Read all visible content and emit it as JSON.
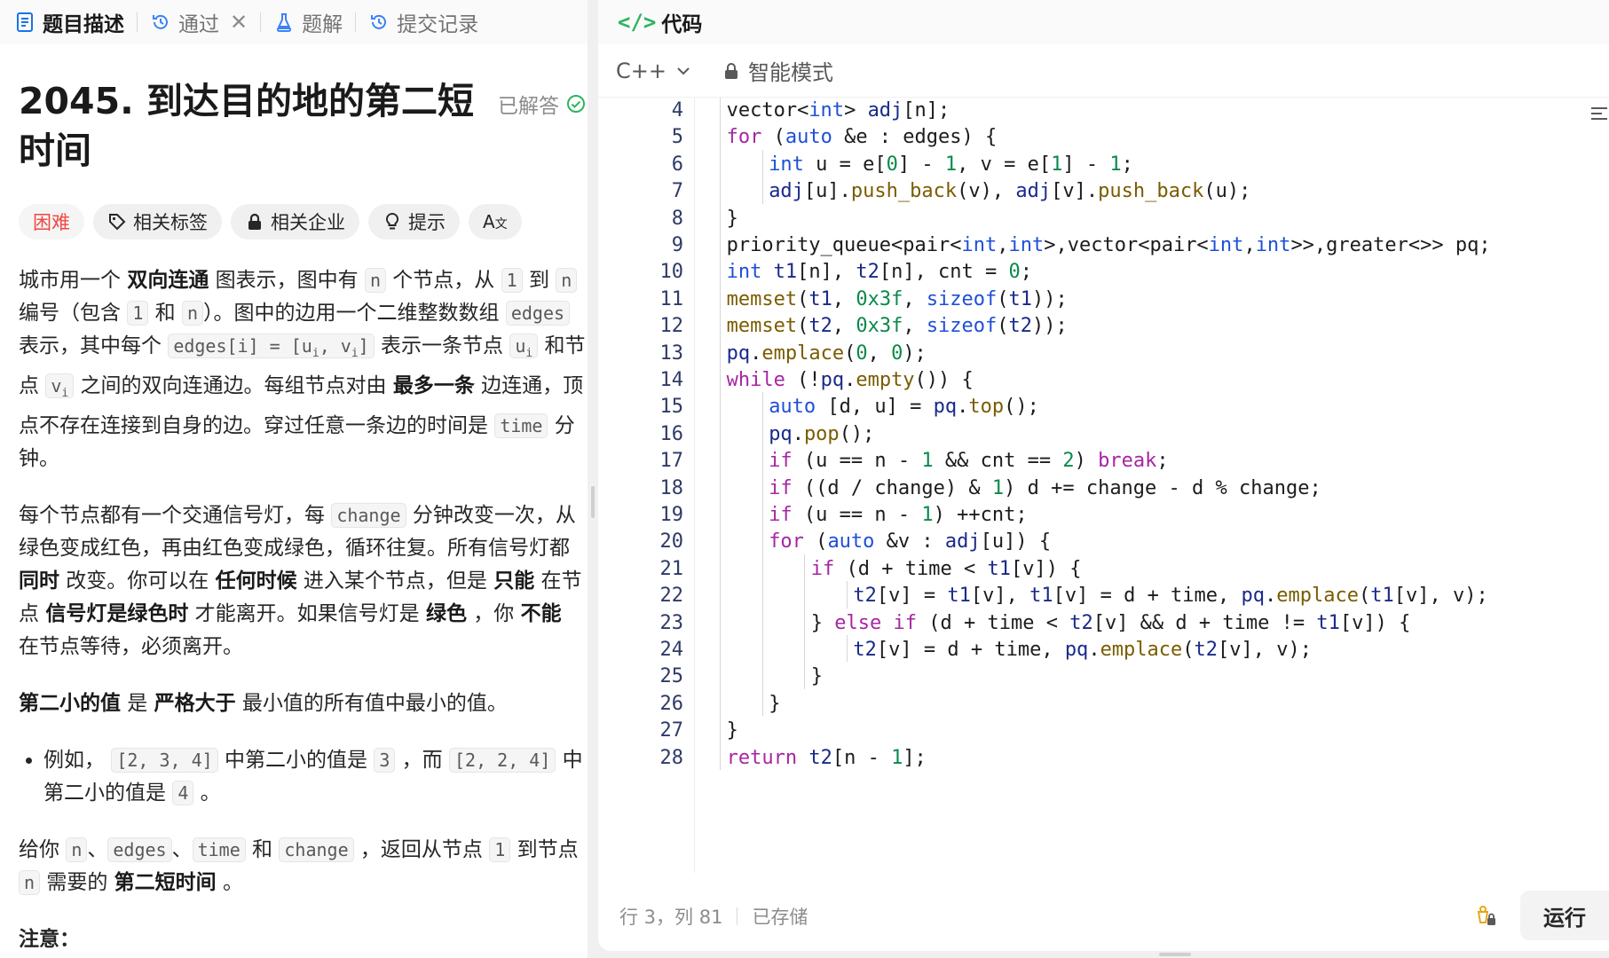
{
  "left_tabs": [
    {
      "label": "题目描述",
      "icon": "document-icon"
    },
    {
      "label": "通过",
      "icon": "history-icon"
    },
    {
      "label": "题解",
      "icon": "flask-icon"
    },
    {
      "label": "提交记录",
      "icon": "history-icon"
    }
  ],
  "question": {
    "title": "2045. 到达目的地的第二短时间",
    "status": "已解答",
    "difficulty": "困难",
    "pills": [
      "相关标签",
      "相关企业",
      "提示"
    ]
  },
  "description": {
    "p1": [
      "城市用一个 ",
      "双向连通",
      " 图表示，图中有 ",
      "n",
      " 个节点，从 ",
      "1",
      " 到 ",
      "n",
      " 编号（包含 ",
      "1",
      " 和 ",
      "n",
      "）。图中的边用一个二维整数数组 ",
      "edges",
      " 表示，其中每个 ",
      "edges[i] = [u",
      "i",
      ", v",
      "i",
      "]",
      " 表示一条节点 ",
      "u",
      "i",
      " 和节点 ",
      "v",
      "i",
      " 之间的双向连通边。每组节点对由 ",
      "最多一条",
      " 边连通，顶点不存在连接到自身的边。穿过任意一条边的时间是 ",
      "time",
      " 分钟。"
    ],
    "p2": [
      "每个节点都有一个交通信号灯，每 ",
      "change",
      " 分钟改变一次，从绿色变成红色，再由红色变成绿色，循环往复。所有信号灯都 ",
      "同时",
      " 改变。你可以在 ",
      "任何时候",
      " 进入某个节点，但是 ",
      "只能",
      " 在节点 ",
      "信号灯是绿色时",
      " 才能离开。如果信号灯是  ",
      "绿色",
      " ，你 ",
      "不能",
      " 在节点等待，必须离开。"
    ],
    "p3": [
      "第二小的值",
      " 是 ",
      "严格大于",
      " 最小值的所有值中最小的值。"
    ],
    "li1": [
      "例如， ",
      "[2, 3, 4]",
      " 中第二小的值是 ",
      "3",
      " ，而 ",
      "[2, 2, 4]",
      " 中第二小的值是 ",
      "4",
      " 。"
    ],
    "p4": [
      "给你 ",
      "n",
      "、",
      "edges",
      "、",
      "time",
      " 和 ",
      "change",
      " ，返回从节点 ",
      "1",
      " 到节点 ",
      "n",
      " 需要的 ",
      "第二短时间",
      " 。"
    ],
    "note": "注意："
  },
  "code_panel": {
    "title": "代码",
    "language": "C++",
    "mode": "智能模式",
    "status_position": "行 3，列 81",
    "status_saved": "已存储",
    "run_label": "运行"
  },
  "code_lines": [
    {
      "n": "4",
      "indent": 1,
      "t": [
        [
          "",
          "vector<"
        ],
        [
          "ty",
          "int"
        ],
        [
          "",
          "> "
        ],
        [
          "vr",
          "adj"
        ],
        [
          "",
          "[n];"
        ]
      ]
    },
    {
      "n": "5",
      "indent": 1,
      "t": [
        [
          "kw",
          "for"
        ],
        [
          "",
          " ("
        ],
        [
          "ty",
          "auto"
        ],
        [
          "",
          " &e : edges) {"
        ]
      ]
    },
    {
      "n": "6",
      "indent": 2,
      "t": [
        [
          "ty",
          "int"
        ],
        [
          "",
          " u = e["
        ],
        [
          "nm",
          "0"
        ],
        [
          "",
          "] - "
        ],
        [
          "nm",
          "1"
        ],
        [
          "",
          ", v = e["
        ],
        [
          "nm",
          "1"
        ],
        [
          "",
          "] - "
        ],
        [
          "nm",
          "1"
        ],
        [
          "",
          ";"
        ]
      ]
    },
    {
      "n": "7",
      "indent": 2,
      "t": [
        [
          "vr",
          "adj"
        ],
        [
          "",
          "[u]."
        ],
        [
          "fn",
          "push_back"
        ],
        [
          "",
          "(v), "
        ],
        [
          "vr",
          "adj"
        ],
        [
          "",
          "[v]."
        ],
        [
          "fn",
          "push_back"
        ],
        [
          "",
          "(u);"
        ]
      ]
    },
    {
      "n": "8",
      "indent": 1,
      "t": [
        [
          "",
          "}"
        ]
      ]
    },
    {
      "n": "9",
      "indent": 1,
      "t": [
        [
          "",
          "priority_queue<pair<"
        ],
        [
          "ty",
          "int"
        ],
        [
          "",
          ","
        ],
        [
          "ty",
          "int"
        ],
        [
          "",
          ">,vector<pair<"
        ],
        [
          "ty",
          "int"
        ],
        [
          "",
          ","
        ],
        [
          "ty",
          "int"
        ],
        [
          "",
          ">>,greater<>> pq;"
        ]
      ]
    },
    {
      "n": "10",
      "indent": 1,
      "t": [
        [
          "ty",
          "int"
        ],
        [
          "",
          " "
        ],
        [
          "vr",
          "t1"
        ],
        [
          "",
          "[n], "
        ],
        [
          "vr",
          "t2"
        ],
        [
          "",
          "[n], cnt = "
        ],
        [
          "nm",
          "0"
        ],
        [
          "",
          ";"
        ]
      ]
    },
    {
      "n": "11",
      "indent": 1,
      "t": [
        [
          "fn",
          "memset"
        ],
        [
          "",
          "("
        ],
        [
          "vr",
          "t1"
        ],
        [
          "",
          ", "
        ],
        [
          "nm",
          "0x3f"
        ],
        [
          "",
          ", "
        ],
        [
          "ty",
          "sizeof"
        ],
        [
          "",
          "("
        ],
        [
          "vr",
          "t1"
        ],
        [
          "",
          "));"
        ]
      ]
    },
    {
      "n": "12",
      "indent": 1,
      "t": [
        [
          "fn",
          "memset"
        ],
        [
          "",
          "("
        ],
        [
          "vr",
          "t2"
        ],
        [
          "",
          ", "
        ],
        [
          "nm",
          "0x3f"
        ],
        [
          "",
          ", "
        ],
        [
          "ty",
          "sizeof"
        ],
        [
          "",
          "("
        ],
        [
          "vr",
          "t2"
        ],
        [
          "",
          "));"
        ]
      ]
    },
    {
      "n": "13",
      "indent": 1,
      "t": [
        [
          "vr",
          "pq"
        ],
        [
          "",
          "."
        ],
        [
          "fn",
          "emplace"
        ],
        [
          "",
          "("
        ],
        [
          "nm",
          "0"
        ],
        [
          "",
          ", "
        ],
        [
          "nm",
          "0"
        ],
        [
          "",
          ");"
        ]
      ]
    },
    {
      "n": "14",
      "indent": 1,
      "t": [
        [
          "kw",
          "while"
        ],
        [
          "",
          " (!"
        ],
        [
          "vr",
          "pq"
        ],
        [
          "",
          "."
        ],
        [
          "fn",
          "empty"
        ],
        [
          "",
          "()) {"
        ]
      ]
    },
    {
      "n": "15",
      "indent": 2,
      "t": [
        [
          "ty",
          "auto"
        ],
        [
          "",
          " [d, u] = "
        ],
        [
          "vr",
          "pq"
        ],
        [
          "",
          "."
        ],
        [
          "fn",
          "top"
        ],
        [
          "",
          "();"
        ]
      ]
    },
    {
      "n": "16",
      "indent": 2,
      "t": [
        [
          "vr",
          "pq"
        ],
        [
          "",
          "."
        ],
        [
          "fn",
          "pop"
        ],
        [
          "",
          "();"
        ]
      ]
    },
    {
      "n": "17",
      "indent": 2,
      "t": [
        [
          "kw",
          "if"
        ],
        [
          "",
          " (u == n - "
        ],
        [
          "nm",
          "1"
        ],
        [
          "",
          " && cnt == "
        ],
        [
          "nm",
          "2"
        ],
        [
          "",
          ") "
        ],
        [
          "kw",
          "break"
        ],
        [
          "",
          ";"
        ]
      ]
    },
    {
      "n": "18",
      "indent": 2,
      "t": [
        [
          "kw",
          "if"
        ],
        [
          "",
          " ((d / change) & "
        ],
        [
          "nm",
          "1"
        ],
        [
          "",
          ") d += change - d % change;"
        ]
      ]
    },
    {
      "n": "19",
      "indent": 2,
      "t": [
        [
          "kw",
          "if"
        ],
        [
          "",
          " (u == n - "
        ],
        [
          "nm",
          "1"
        ],
        [
          "",
          ") ++cnt;"
        ]
      ]
    },
    {
      "n": "20",
      "indent": 2,
      "t": [
        [
          "kw",
          "for"
        ],
        [
          "",
          " ("
        ],
        [
          "ty",
          "auto"
        ],
        [
          "",
          " &v : "
        ],
        [
          "vr",
          "adj"
        ],
        [
          "",
          "[u]) {"
        ]
      ]
    },
    {
      "n": "21",
      "indent": 3,
      "t": [
        [
          "kw",
          "if"
        ],
        [
          "",
          " (d + time < "
        ],
        [
          "vr",
          "t1"
        ],
        [
          "",
          "[v]) {"
        ]
      ]
    },
    {
      "n": "22",
      "indent": 4,
      "t": [
        [
          "vr",
          "t2"
        ],
        [
          "",
          "[v] = "
        ],
        [
          "vr",
          "t1"
        ],
        [
          "",
          "[v], "
        ],
        [
          "vr",
          "t1"
        ],
        [
          "",
          "[v] = d + time, "
        ],
        [
          "vr",
          "pq"
        ],
        [
          "",
          "."
        ],
        [
          "fn",
          "emplace"
        ],
        [
          "",
          "("
        ],
        [
          "vr",
          "t1"
        ],
        [
          "",
          "[v], v);"
        ]
      ]
    },
    {
      "n": "23",
      "indent": 3,
      "t": [
        [
          "",
          "} "
        ],
        [
          "kw",
          "else if"
        ],
        [
          "",
          " (d + time < "
        ],
        [
          "vr",
          "t2"
        ],
        [
          "",
          "[v] && d + time != "
        ],
        [
          "vr",
          "t1"
        ],
        [
          "",
          "[v]) {"
        ]
      ]
    },
    {
      "n": "24",
      "indent": 4,
      "t": [
        [
          "vr",
          "t2"
        ],
        [
          "",
          "[v] = d + time, "
        ],
        [
          "vr",
          "pq"
        ],
        [
          "",
          "."
        ],
        [
          "fn",
          "emplace"
        ],
        [
          "",
          "("
        ],
        [
          "vr",
          "t2"
        ],
        [
          "",
          "[v], v);"
        ]
      ]
    },
    {
      "n": "25",
      "indent": 3,
      "t": [
        [
          "",
          "}"
        ]
      ]
    },
    {
      "n": "26",
      "indent": 2,
      "t": [
        [
          "",
          "}"
        ]
      ]
    },
    {
      "n": "27",
      "indent": 1,
      "t": [
        [
          "",
          "}"
        ]
      ]
    },
    {
      "n": "28",
      "indent": 1,
      "t": [
        [
          "kw",
          "return"
        ],
        [
          "",
          " "
        ],
        [
          "vr",
          "t2"
        ],
        [
          "",
          "[n - "
        ],
        [
          "nm",
          "1"
        ],
        [
          "",
          "];"
        ]
      ]
    }
  ]
}
